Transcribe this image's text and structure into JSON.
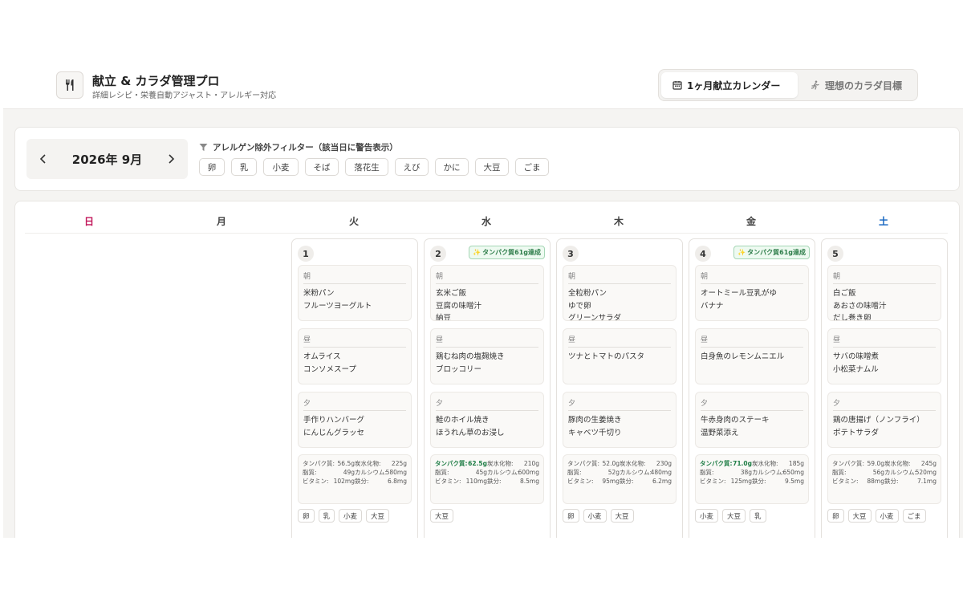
{
  "app": {
    "title": "献立 & カラダ管理プロ",
    "subtitle": "詳細レシピ・栄養自動アジャスト・アレルギー対応",
    "logo_icon": "fork-knife-icon"
  },
  "nav": {
    "tabs": [
      {
        "label": "1ヶ月献立カレンダー",
        "icon": "calendar-icon",
        "active": true
      },
      {
        "label": "理想のカラダ目標",
        "icon": "runner-icon",
        "active": false
      }
    ]
  },
  "month": {
    "label": "2026年 9月"
  },
  "filter": {
    "title": "アレルゲン除外フィルター（該当日に警告表示）",
    "allergens": [
      "卵",
      "乳",
      "小麦",
      "そば",
      "落花生",
      "えび",
      "かに",
      "大豆",
      "ごま"
    ]
  },
  "weekdays": [
    "日",
    "月",
    "火",
    "水",
    "木",
    "金",
    "土"
  ],
  "colors": {
    "sunday": "#c2185b",
    "saturday": "#1565c0",
    "accent_green": "#2e7d4a"
  },
  "labels": {
    "breakfast": "朝",
    "lunch": "昼",
    "dinner": "夕",
    "protein": "タンパク質:",
    "carbs": "炭水化物:",
    "fat": "脂質:",
    "calcium": "カルシウム:",
    "vitamin": "ビタミン:",
    "iron": "鉄分:"
  },
  "days": [
    {
      "num": "1",
      "badge": "",
      "breakfast": [
        "米粉パン",
        "フルーツヨーグルト"
      ],
      "lunch": [
        "オムライス",
        "コンソメスープ"
      ],
      "dinner": [
        "手作りハンバーグ",
        "にんじんグラッセ"
      ],
      "nutrition": {
        "protein": "56.5g",
        "carbs": "225g",
        "fat": "49g",
        "calcium": "580mg",
        "vitamin": "102mg",
        "iron": "6.8mg",
        "protein_ok": false
      },
      "tags": [
        "卵",
        "乳",
        "小麦",
        "大豆"
      ]
    },
    {
      "num": "2",
      "badge": "タンパク質61g達成",
      "breakfast": [
        "玄米ご飯",
        "豆腐の味噌汁",
        "納豆"
      ],
      "lunch": [
        "鶏むね肉の塩麹焼き",
        "ブロッコリー"
      ],
      "dinner": [
        "鮭のホイル焼き",
        "ほうれん草のお浸し"
      ],
      "nutrition": {
        "protein": "62.5g",
        "carbs": "210g",
        "fat": "45g",
        "calcium": "600mg",
        "vitamin": "110mg",
        "iron": "8.5mg",
        "protein_ok": true
      },
      "tags": [
        "大豆"
      ]
    },
    {
      "num": "3",
      "badge": "",
      "breakfast": [
        "全粒粉パン",
        "ゆで卵",
        "グリーンサラダ"
      ],
      "lunch": [
        "ツナとトマトのパスタ"
      ],
      "dinner": [
        "豚肉の生姜焼き",
        "キャベツ千切り"
      ],
      "nutrition": {
        "protein": "52.0g",
        "carbs": "230g",
        "fat": "52g",
        "calcium": "480mg",
        "vitamin": "95mg",
        "iron": "6.2mg",
        "protein_ok": false
      },
      "tags": [
        "卵",
        "小麦",
        "大豆"
      ]
    },
    {
      "num": "4",
      "badge": "タンパク質61g達成",
      "breakfast": [
        "オートミール豆乳がゆ",
        "バナナ"
      ],
      "lunch": [
        "白身魚のレモンムニエル"
      ],
      "dinner": [
        "牛赤身肉のステーキ",
        "温野菜添え"
      ],
      "nutrition": {
        "protein": "71.0g",
        "carbs": "185g",
        "fat": "38g",
        "calcium": "650mg",
        "vitamin": "125mg",
        "iron": "9.5mg",
        "protein_ok": true
      },
      "tags": [
        "小麦",
        "大豆",
        "乳"
      ]
    },
    {
      "num": "5",
      "badge": "",
      "breakfast": [
        "白ご飯",
        "あおさの味噌汁",
        "だし巻き卵"
      ],
      "lunch": [
        "サバの味噌煮",
        "小松菜ナムル"
      ],
      "dinner": [
        "鶏の唐揚げ（ノンフライ）",
        "ポテトサラダ"
      ],
      "nutrition": {
        "protein": "59.0g",
        "carbs": "245g",
        "fat": "56g",
        "calcium": "520mg",
        "vitamin": "88mg",
        "iron": "7.1mg",
        "protein_ok": false
      },
      "tags": [
        "卵",
        "大豆",
        "小麦",
        "ごま"
      ]
    }
  ]
}
